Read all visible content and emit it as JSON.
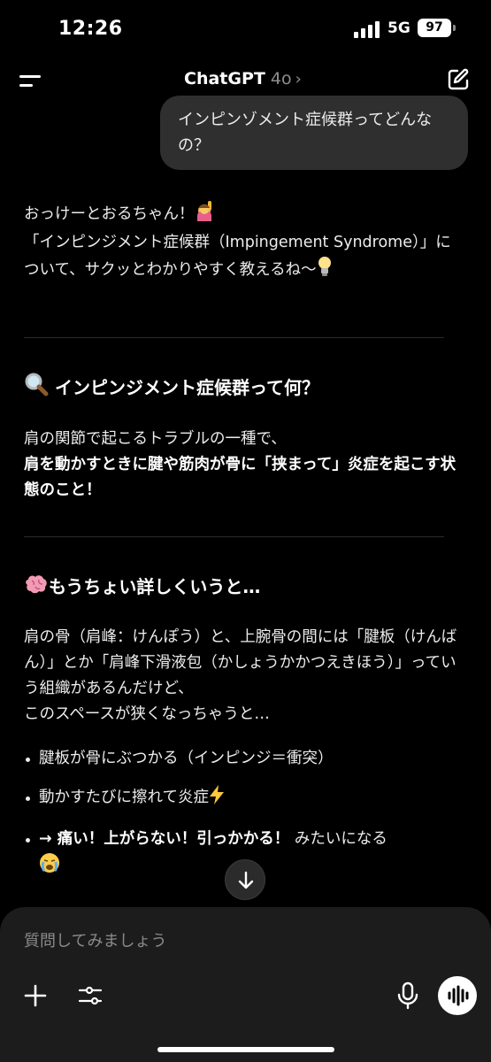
{
  "status": {
    "time": "12:26",
    "network": "5G",
    "battery": "97"
  },
  "header": {
    "title": "ChatGPT",
    "model": "4o",
    "chevron": "›"
  },
  "user_message": "インピンゾメント症候群ってどんなの？",
  "assistant": {
    "intro_line1": "おっけーとおるちゃん！",
    "intro_line2": "「インピンジメント症候群（Impingement Syndrome）」について、サクッとわかりやすく教えるね〜",
    "section1": {
      "heading": "インピンジメント症候群って何？",
      "line1": "肩の関節で起こるトラブルの一種で、",
      "line2_bold": "肩を動かすときに腱や筋肉が骨に「挟まって」炎症を起こす状態のこと！"
    },
    "section2": {
      "heading": "もうちょい詳しくいうと…",
      "para": "肩の骨（肩峰：けんぽう）と、上腕骨の間には「腱板（けんばん）」とか「肩峰下滑液包（かしょうかかつえきほう）」っていう組織があるんだけど、",
      "para2": "このスペースが狭くなっちゃうと…",
      "bullets": [
        {
          "text": "腱板が骨にぶつかる（インピンジ＝衝突）"
        },
        {
          "text": "動かすたびに擦れて炎症"
        },
        {
          "bold": "→ 痛い！上がらない！引っかかる！",
          "text": " みたいになる"
        }
      ]
    }
  },
  "composer": {
    "placeholder": "質問してみましょう"
  },
  "icons": {
    "menu": "menu-icon",
    "edit": "new-chat-icon",
    "search": "magnifier-icon",
    "brain": "brain-icon",
    "raising_hand": "raising-hand-icon",
    "bulb": "light-bulb-icon",
    "zap": "lightning-icon",
    "crying": "crying-face-icon",
    "plus": "plus-icon",
    "tools": "sliders-icon",
    "mic": "microphone-icon",
    "voice": "voice-waveform-icon",
    "down": "arrow-down-icon"
  }
}
